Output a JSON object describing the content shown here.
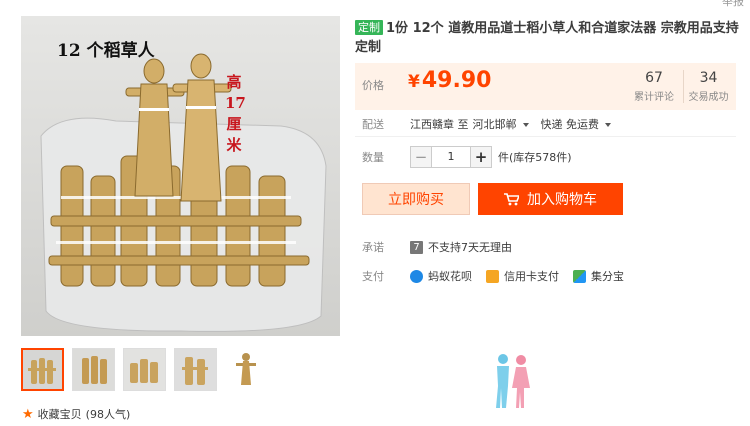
{
  "header": {
    "report_link": "举报"
  },
  "gallery": {
    "main_caption_count": "12 个稻草人",
    "main_caption_height": "高17厘米",
    "thumbnails": [
      "thumb-1",
      "thumb-2",
      "thumb-3",
      "thumb-4",
      "thumb-5"
    ],
    "favorite": {
      "label": "收藏宝贝",
      "count": "(98人气)"
    }
  },
  "product": {
    "tag": "定制",
    "title": "1份 12个 道教用品道士稻小草人和合道家法器 宗教用品支持定制"
  },
  "price": {
    "label": "价格",
    "currency": "¥",
    "amount": "49.90",
    "reviews_count": "67",
    "reviews_label": "累计评论",
    "sales_count": "34",
    "sales_label": "交易成功"
  },
  "shipping": {
    "label": "配送",
    "from": "江西赣章 至",
    "to": "河北邯郸",
    "method": "快递 免运费"
  },
  "quantity": {
    "label": "数量",
    "value": "1",
    "unit_stock": "件(库存578件)",
    "minus": "−",
    "plus": "+"
  },
  "actions": {
    "buy_now": "立即购买",
    "add_to_cart": "加入购物车"
  },
  "promise": {
    "label": "承诺",
    "icon_text": "7",
    "text": "不支持7天无理由"
  },
  "payment": {
    "label": "支付",
    "methods": [
      {
        "name": "蚂蚁花呗",
        "color": "#1e88e5"
      },
      {
        "name": "信用卡支付",
        "color": "#f5a623"
      },
      {
        "name": "集分宝",
        "color": "#4caf50"
      }
    ]
  },
  "colors": {
    "accent": "#ff4400",
    "tag_green": "#35b558",
    "price_bg": "#fff2e8"
  }
}
